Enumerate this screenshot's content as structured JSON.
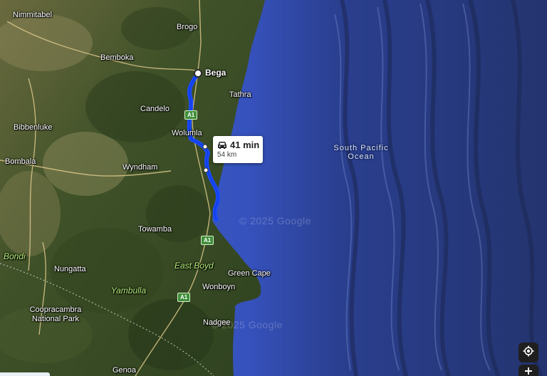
{
  "map": {
    "places": {
      "nimmitabel": "Nimmitabel",
      "brogo": "Brogo",
      "bemboka": "Bemboka",
      "bega": "Bega",
      "tathra": "Tathra",
      "candelo": "Candelo",
      "bibbenluke": "Bibbenluke",
      "wolumla": "Wolumla",
      "bombala": "Bombala",
      "wyndham": "Wyndham",
      "towamba": "Towamba",
      "bondi": "Bondi",
      "nungatta": "Nungatta",
      "east_boyd": "East Boyd",
      "green_cape": "Green Cape",
      "yambulla": "Yambulla",
      "wonboyn": "Wonboyn",
      "coopracambra": "Coopracambra\nNational Park",
      "nadgee": "Nadgee",
      "genoa": "Genoa"
    },
    "ocean_label": "South Pacific\nOcean",
    "watermark_1": "© 2025 Google",
    "watermark_2": "© 2025 Google",
    "road_shields": [
      "A1",
      "A1",
      "A1"
    ],
    "route": {
      "duration": "41 min",
      "distance": "54 km",
      "mode_icon": "car-icon",
      "color": "#1a4bff"
    },
    "controls": {
      "location_icon": "my-location-icon",
      "zoom_in_icon": "plus-icon"
    },
    "colors": {
      "land": "#4a5a2e",
      "ocean": "#3c57c2",
      "deep_ocean": "#26356d"
    }
  }
}
